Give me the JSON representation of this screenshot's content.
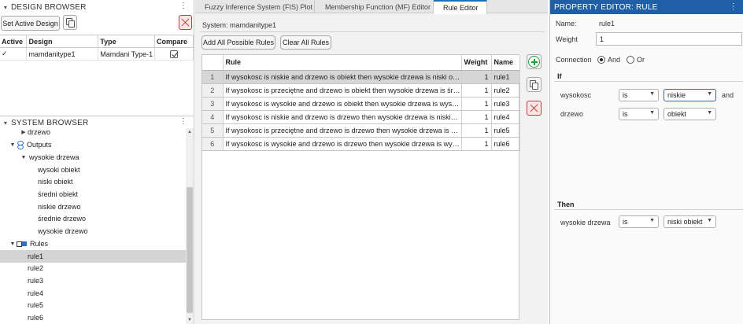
{
  "design_browser": {
    "title": "DESIGN BROWSER",
    "set_active_label": "Set Active Design",
    "columns": [
      "Active",
      "Design",
      "Type",
      "Compare"
    ],
    "rows": [
      {
        "active": "✓",
        "design": "mamdanitype1",
        "type": "Mamdani Type-1",
        "compare": true
      }
    ]
  },
  "system_browser": {
    "title": "SYSTEM BROWSER",
    "items": [
      {
        "label": "drzewo",
        "kind": "collapsed-var"
      },
      {
        "label": "Outputs",
        "kind": "group"
      },
      {
        "label": "wysokie drzewa",
        "kind": "expanded-var"
      },
      {
        "label": "wysoki obiekt",
        "kind": "mf"
      },
      {
        "label": "niski obiekt",
        "kind": "mf"
      },
      {
        "label": "średni obiekt",
        "kind": "mf"
      },
      {
        "label": "niskie drzewo",
        "kind": "mf"
      },
      {
        "label": "średnie drzewo",
        "kind": "mf"
      },
      {
        "label": "wysokie drzewo",
        "kind": "mf"
      },
      {
        "label": "Rules",
        "kind": "group"
      },
      {
        "label": "rule1",
        "kind": "rule",
        "selected": true
      },
      {
        "label": "rule2",
        "kind": "rule"
      },
      {
        "label": "rule3",
        "kind": "rule"
      },
      {
        "label": "rule4",
        "kind": "rule"
      },
      {
        "label": "rule5",
        "kind": "rule"
      },
      {
        "label": "rule6",
        "kind": "rule"
      }
    ]
  },
  "tabs": [
    {
      "label": "Fuzzy Inference System (FIS) Plot",
      "active": false
    },
    {
      "label": "Membership Function (MF) Editor",
      "active": false
    },
    {
      "label": "Rule Editor",
      "active": true
    }
  ],
  "rule_editor": {
    "system_label": "System: mamdanitype1",
    "add_all_label": "Add All Possible Rules",
    "clear_all_label": "Clear All Rules",
    "columns": [
      "",
      "Rule",
      "Weight",
      "Name"
    ],
    "rules": [
      {
        "num": "1",
        "rule": "If wysokosc is niskie and drzewo is obiekt then wysokie drzewa is niski obiekt",
        "weight": "1",
        "name": "rule1",
        "selected": true
      },
      {
        "num": "2",
        "rule": "If wysokosc is przeciętne and drzewo is obiekt then wysokie drzewa is średni obiekt",
        "weight": "1",
        "name": "rule2"
      },
      {
        "num": "3",
        "rule": "If wysokosc is wysokie and drzewo is obiekt then wysokie drzewa is wysoki obiekt",
        "weight": "1",
        "name": "rule3"
      },
      {
        "num": "4",
        "rule": "If wysokosc is niskie and drzewo is drzewo then wysokie drzewa is niskie drzewo",
        "weight": "1",
        "name": "rule4"
      },
      {
        "num": "5",
        "rule": "If wysokosc is przeciętne and drzewo is drzewo then wysokie drzewa is średnie drzewo",
        "weight": "1",
        "name": "rule5"
      },
      {
        "num": "6",
        "rule": "If wysokosc is wysokie and drzewo is drzewo then wysokie drzewa is wysokie drzewo",
        "weight": "1",
        "name": "rule6"
      }
    ]
  },
  "property_editor": {
    "title": "PROPERTY EDITOR: RULE",
    "name_label": "Name:",
    "name_value": "rule1",
    "weight_label": "Weight",
    "weight_value": "1",
    "connection_label": "Connection",
    "and_label": "And",
    "or_label": "Or",
    "connection_selected": "And",
    "if_title": "If",
    "then_title": "Then",
    "antecedents": [
      {
        "variable": "wysokosc",
        "operator": "is",
        "value": "niskie",
        "conjunction": "and"
      },
      {
        "variable": "drzewo",
        "operator": "is",
        "value": "obiekt",
        "conjunction": ""
      }
    ],
    "consequents": [
      {
        "variable": "wysokie drzewa",
        "operator": "is",
        "value": "niski obiekt"
      }
    ]
  },
  "colors": {
    "accent": "#1f5fa8",
    "selection": "#d6d6d6",
    "add": "#22a03a",
    "delete": "#c83a3a"
  }
}
